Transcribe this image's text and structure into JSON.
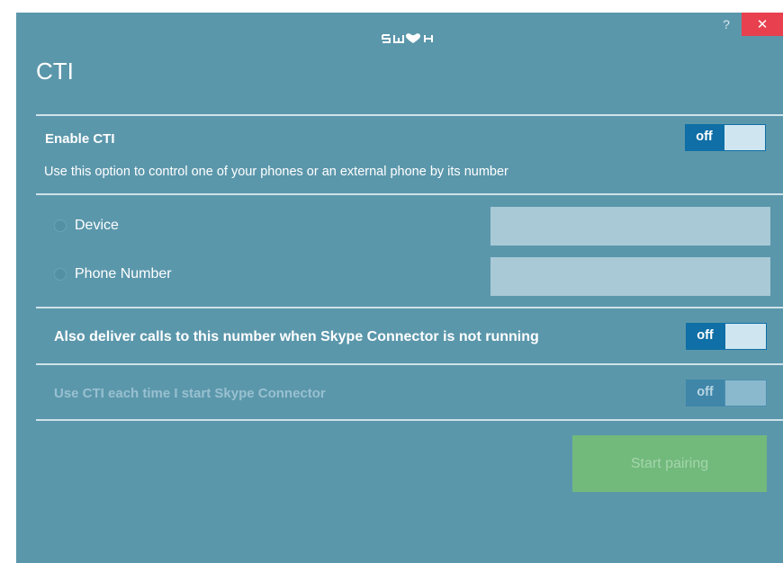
{
  "window": {
    "logo_text": "swox",
    "help_label": "?",
    "close_label": "✕"
  },
  "page": {
    "title": "CTI"
  },
  "enable_cti": {
    "label": "Enable CTI",
    "toggle_label": "off",
    "description": "Use this option to control one of your phones or an external phone by its number"
  },
  "options": {
    "device_label": "Device",
    "device_value": "",
    "phone_label": "Phone Number",
    "phone_value": ""
  },
  "deliver_calls": {
    "label": "Also deliver calls to this number when Skype Connector is not running",
    "toggle_label": "off"
  },
  "use_cti_startup": {
    "label": "Use CTI each time I start Skype Connector",
    "toggle_label": "off"
  },
  "start_button": {
    "label": "Start pairing"
  },
  "colors": {
    "background": "#5b97ab",
    "toggle_on": "#0f6fa6",
    "close": "#e8404e",
    "start_button": "#72b97c"
  }
}
